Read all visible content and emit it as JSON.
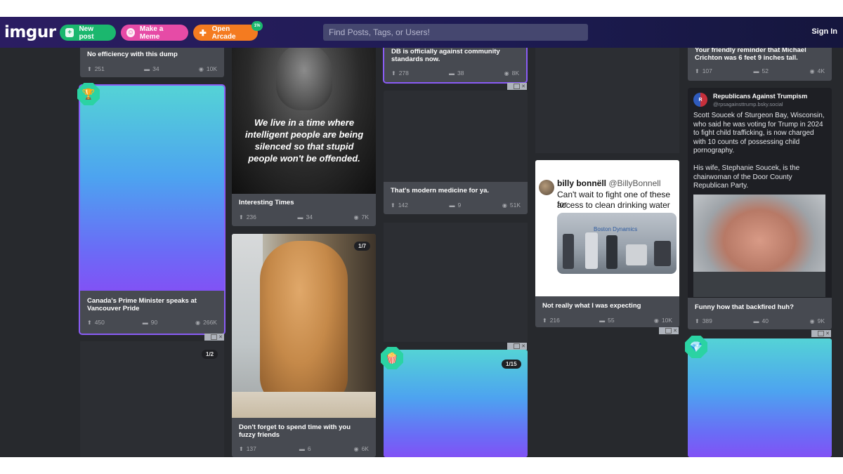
{
  "header": {
    "logo": "imgur",
    "new_post": "New post",
    "make_meme": "Make a Meme",
    "open_arcade": "Open Arcade",
    "arcade_badge": "1%",
    "search_placeholder": "Find Posts, Tags, or Users!",
    "sign_in": "Sign In"
  },
  "posts": {
    "p1": {
      "title": "No efficiency with this dump",
      "ups": "251",
      "comments": "34",
      "views": "10K"
    },
    "p2": {
      "title": "Canada's Prime Minister speaks at Vancouver Pride",
      "ups": "450",
      "comments": "90",
      "views": "266K",
      "counter": "1/2"
    },
    "p3": {
      "quote": "We live in a time where intelligent people are being silenced so that stupid people won't be offended.",
      "title": "Interesting Times",
      "ups": "236",
      "comments": "34",
      "views": "7K"
    },
    "p4": {
      "counter": "1/7",
      "title": "Don't forget to spend time with you fuzzy friends",
      "ups": "137",
      "comments": "6",
      "views": "6K"
    },
    "p5": {
      "title": "DB is officially against community standards now.",
      "ups": "278",
      "comments": "38",
      "views": "8K"
    },
    "p6": {
      "title": "That's modern medicine for ya.",
      "ups": "142",
      "comments": "9",
      "views": "51K"
    },
    "p7": {
      "counter": "1/15"
    },
    "p8": {
      "tweet_name": "billy bonnëll",
      "tweet_handle": "@BillyBonnell",
      "tweet_text_1": "Can't wait to fight one of these for",
      "tweet_text_2": "access to clean drinking water",
      "robot_brand": "Boston Dynamics",
      "title": "Not really what I was expecting",
      "ups": "216",
      "comments": "55",
      "views": "10K"
    },
    "p9": {
      "title": "Your friendly reminder that Michael Crichton was 6 feet 9 inches tall.",
      "ups": "107",
      "comments": "52",
      "views": "4K"
    },
    "p10": {
      "account_name": "Republicans Against Trumpism",
      "account_handle": "@rpsagainsttrump.bsky.social",
      "para1": "Scott Soucek of Sturgeon Bay, Wisconsin, who said he was voting for Trump in 2024 to fight child trafficking, is now charged with 10 counts of possessing child pornography.",
      "para2": "His wife, Stephanie Soucek, is the chairwoman of the Door County Republican Party.",
      "title": "Funny how that backfired huh?",
      "ups": "389",
      "comments": "40",
      "views": "9K"
    }
  },
  "icons": {
    "upvote": "arrow-up-icon",
    "comment": "comment-icon",
    "views": "eye-icon"
  },
  "colors": {
    "accent_highlight": "#8a5cf6",
    "new_post": "#1bb76e",
    "make_meme": "#e64ba6",
    "open_arcade": "#f47b20"
  }
}
